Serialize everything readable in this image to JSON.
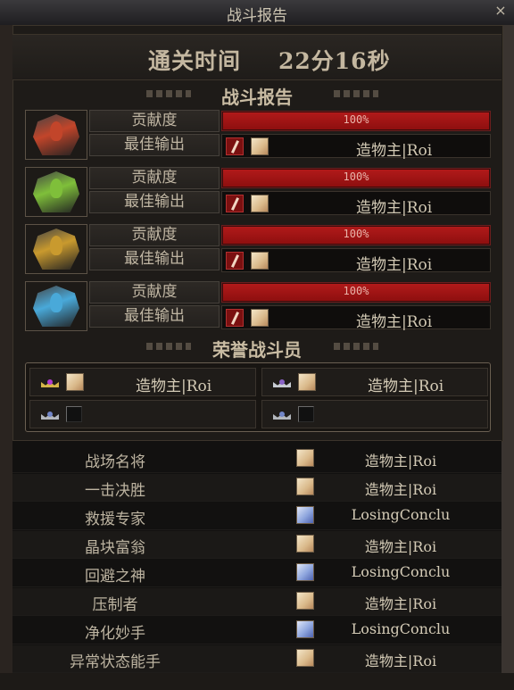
{
  "window": {
    "title": "战斗报告",
    "close_label": "×"
  },
  "clear_time": {
    "label": "通关时间",
    "value": "22分16秒"
  },
  "battle_report": {
    "heading": "战斗报告",
    "contribution_label": "贡献度",
    "best_output_label": "最佳输出",
    "rows": [
      {
        "portrait_color": "#c2452a",
        "contribution": "100%",
        "contribution_fraction": 1.0,
        "best_player": "造物主|Roi"
      },
      {
        "portrait_color": "#7fbf3a",
        "contribution": "100%",
        "contribution_fraction": 1.0,
        "best_player": "造物主|Roi"
      },
      {
        "portrait_color": "#c99a2e",
        "contribution": "100%",
        "contribution_fraction": 1.0,
        "best_player": "造物主|Roi"
      },
      {
        "portrait_color": "#49a9d9",
        "contribution": "100%",
        "contribution_fraction": 1.0,
        "best_player": "造物主|Roi"
      }
    ]
  },
  "honor": {
    "heading": "荣誉战斗员",
    "slots": [
      {
        "name": "造物主|Roi",
        "filled": true
      },
      {
        "name": "造物主|Roi",
        "filled": true
      },
      {
        "name": "",
        "filled": false
      },
      {
        "name": "",
        "filled": false
      }
    ]
  },
  "awards": [
    {
      "title": "战场名将",
      "player": "造物主|Roi",
      "icon": "portrait-icon"
    },
    {
      "title": "一击决胜",
      "player": "造物主|Roi",
      "icon": "portrait-icon"
    },
    {
      "title": "救援专家",
      "player": "LosingConclu",
      "icon": "portrait-blue-icon"
    },
    {
      "title": "晶块富翁",
      "player": "造物主|Roi",
      "icon": "portrait-icon"
    },
    {
      "title": "回避之神",
      "player": "LosingConclu",
      "icon": "portrait-blue-icon"
    },
    {
      "title": "压制者",
      "player": "造物主|Roi",
      "icon": "portrait-icon"
    },
    {
      "title": "净化妙手",
      "player": "LosingConclu",
      "icon": "portrait-blue-icon"
    },
    {
      "title": "异常状态能手",
      "player": "造物主|Roi",
      "icon": "portrait-icon"
    }
  ]
}
